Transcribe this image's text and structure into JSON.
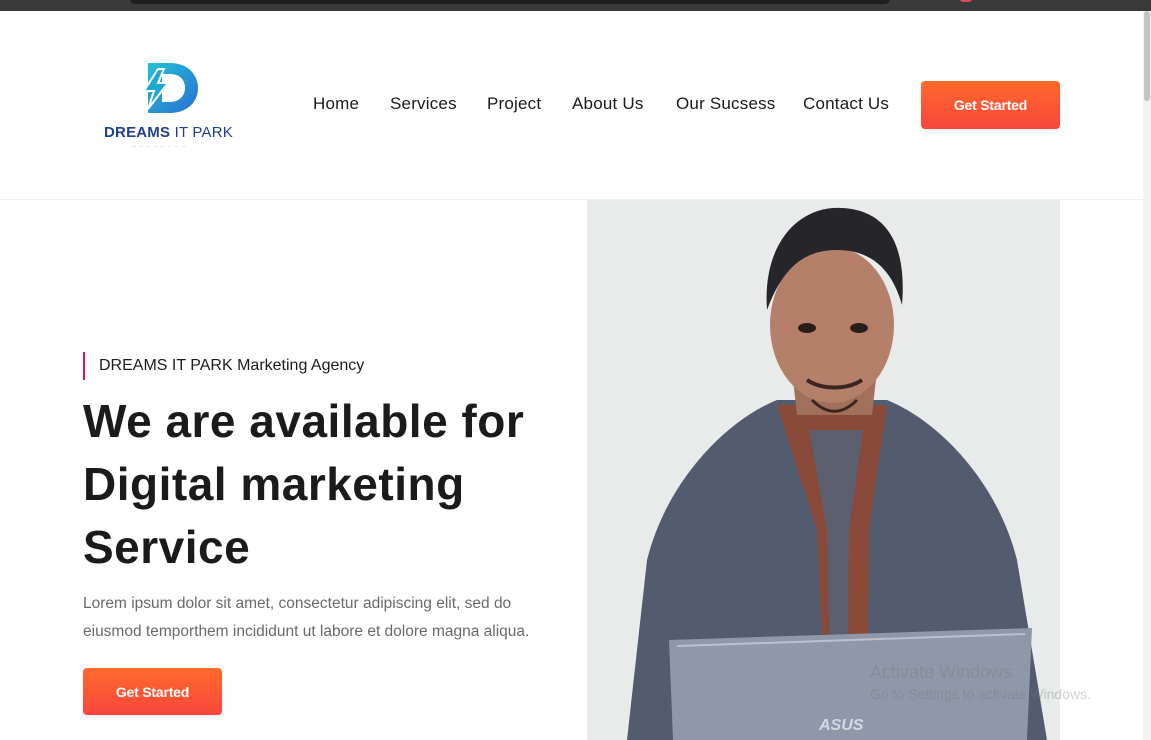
{
  "brand": {
    "name_bold": "DREAMS",
    "name_rest": " IT PARK",
    "logo_colors": [
      "#1bb3c9",
      "#2e6fd1"
    ]
  },
  "nav": {
    "items": [
      "Home",
      "Services",
      "Project",
      "About Us",
      "Our Sucsess",
      "Contact Us"
    ],
    "cta_label": "Get Started"
  },
  "hero": {
    "eyebrow": "DREAMS IT PARK Marketing Agency",
    "title": "We are available for Digital marketing Service",
    "description": "Lorem ipsum dolor sit amet, consectetur adipiscing elit, sed do eiusmod temporthem incididunt ut labore et dolore magna aliqua.",
    "cta_label": "Get Started",
    "image_alt": "portrait-photo",
    "accent_color": "#d8144b",
    "button_color": "#ff5a36"
  },
  "os_watermark": {
    "line1": "Activate Windows",
    "line2": "Go to Settings to activate Windows."
  }
}
